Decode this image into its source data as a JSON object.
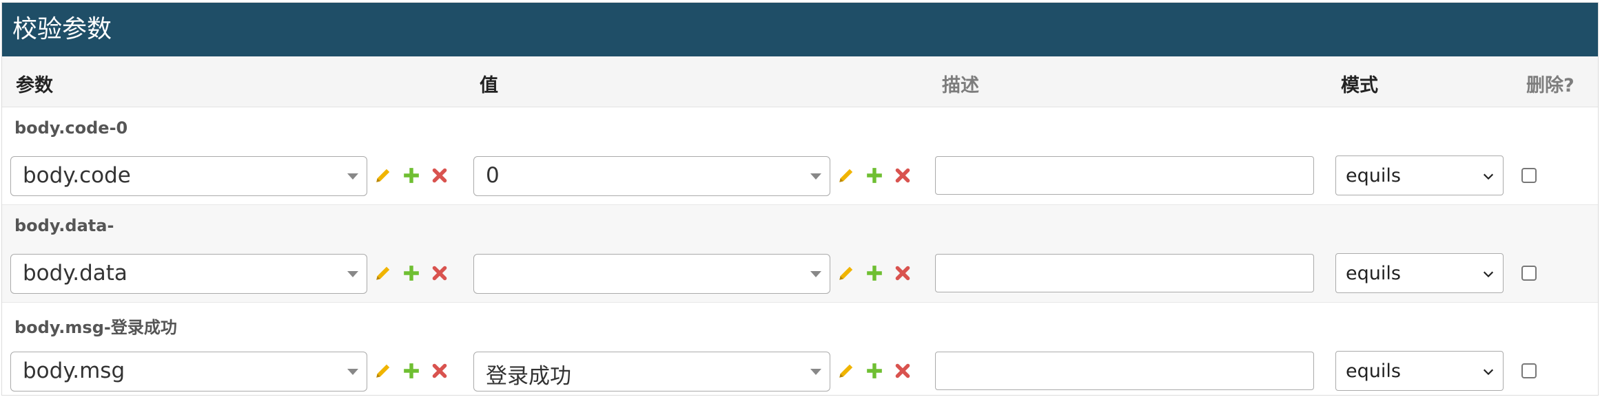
{
  "panel": {
    "title": "校验参数"
  },
  "columns": {
    "param": "参数",
    "value": "值",
    "desc": "描述",
    "mode": "模式",
    "delete": "删除?"
  },
  "rows": [
    {
      "title": "body.code-0",
      "param": "body.code",
      "value": "0",
      "desc": "",
      "mode": "equils",
      "delete_checked": false
    },
    {
      "title": "body.data-",
      "param": "body.data",
      "value": "",
      "desc": "",
      "mode": "equils",
      "delete_checked": false
    },
    {
      "title": "body.msg-登录成功",
      "param": "body.msg",
      "value": "登录成功",
      "desc": "",
      "mode": "equils",
      "delete_checked": false
    }
  ],
  "icons": {
    "edit": "pencil-icon",
    "add": "plus-icon",
    "remove": "close-icon",
    "select": "chevron-down-icon"
  },
  "colors": {
    "header_bg": "#1f4e67",
    "edit_icon": "#f0b400",
    "add_icon": "#6fbf32",
    "remove_icon": "#d9534f"
  }
}
